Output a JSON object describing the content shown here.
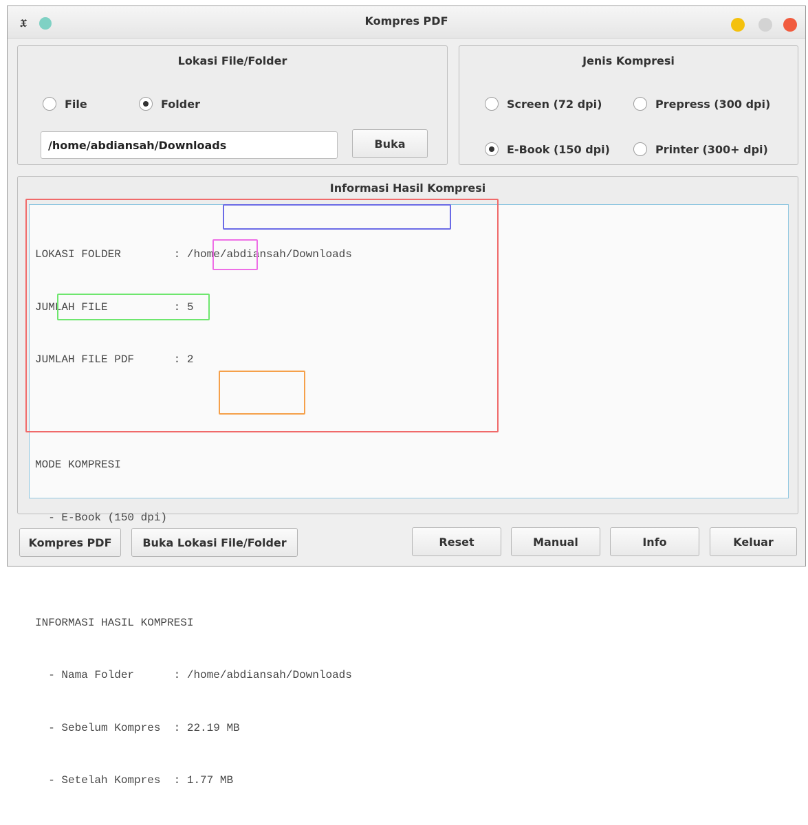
{
  "window": {
    "title": "Kompres PDF",
    "app_icon": "x-app-icon"
  },
  "location": {
    "group_title": "Lokasi File/Folder",
    "radio_file": "File",
    "radio_folder": "Folder",
    "selected": "Folder",
    "path_value": "/home/abdiansah/Downloads",
    "open_button": "Buka"
  },
  "compression": {
    "group_title": "Jenis Kompresi",
    "options": [
      "Screen (72 dpi)",
      "Prepress (300 dpi)",
      "E-Book (150 dpi)",
      "Printer (300+ dpi)"
    ],
    "selected": "E-Book (150 dpi)"
  },
  "result": {
    "group_title": "Informasi Hasil Kompresi",
    "lines": [
      "LOKASI FOLDER        : /home/abdiansah/Downloads",
      "JUMLAH FILE          : 5",
      "JUMLAH FILE PDF      : 2",
      "",
      "MODE KOMPRESI",
      "  - E-Book (150 dpi)",
      "",
      "INFORMASI HASIL KOMPRESI",
      "  - Nama Folder      : /home/abdiansah/Downloads",
      "  - Sebelum Kompres  : 22.19 MB",
      "  - Setelah Kompres  : 1.77 MB"
    ],
    "highlight_colors": {
      "outer": "#f06a6a",
      "path": "#6a6ae6",
      "pdf_count": "#ee6ee6",
      "mode": "#6ee66e",
      "sizes": "#f5a04a"
    }
  },
  "buttons": {
    "compress": "Kompres PDF",
    "open_location": "Buka Lokasi File/Folder",
    "reset": "Reset",
    "manual": "Manual",
    "info": "Info",
    "exit": "Keluar"
  }
}
